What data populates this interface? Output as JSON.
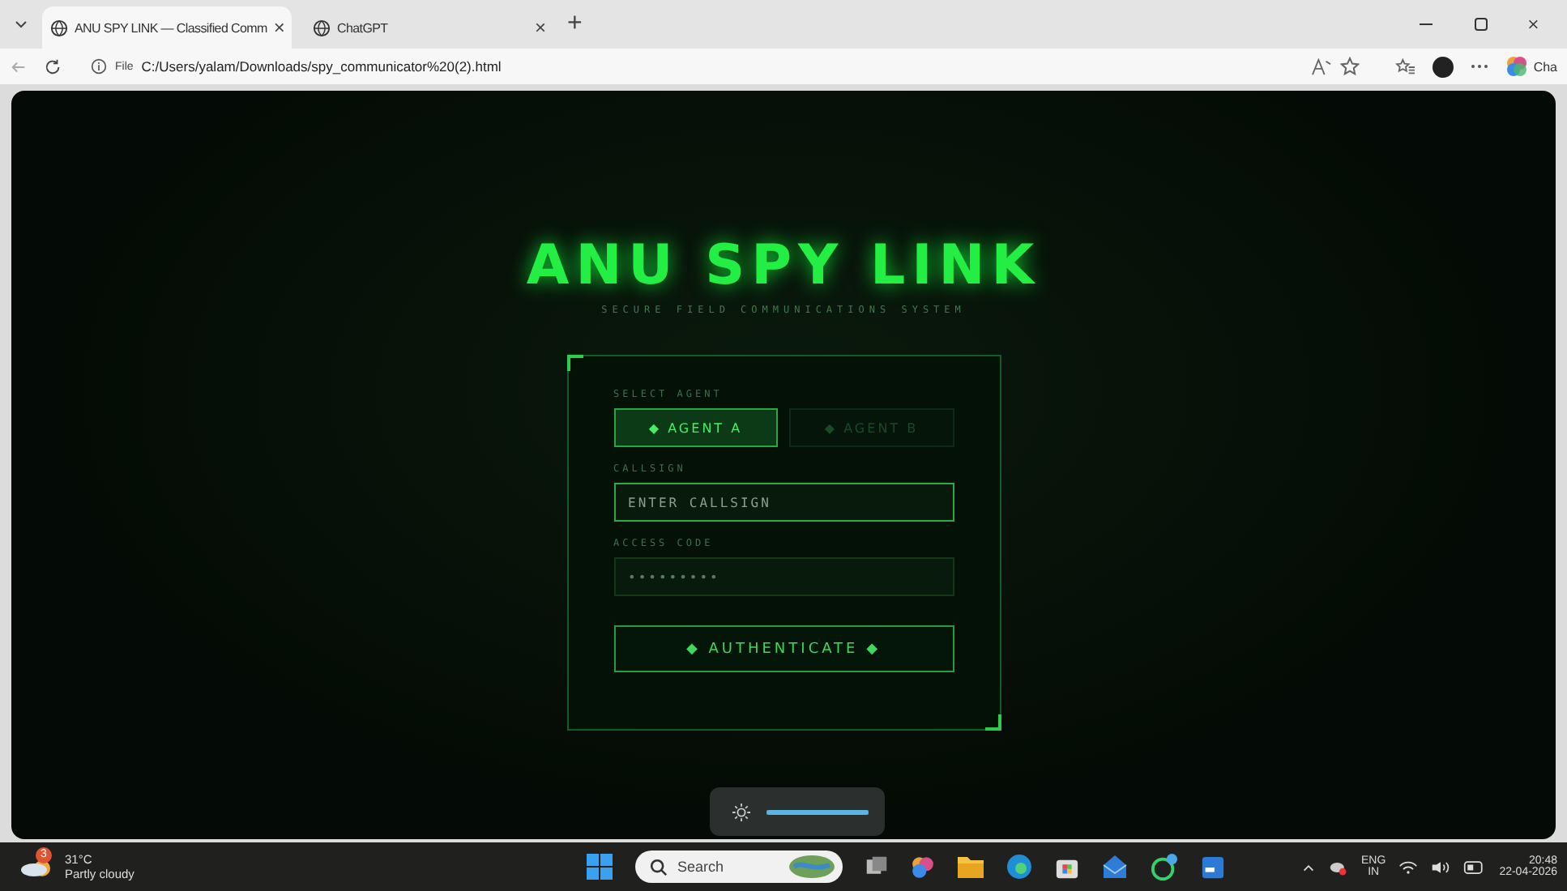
{
  "browser": {
    "tabs": [
      {
        "title": "ANU SPY LINK — Classified Comm",
        "selected": true
      },
      {
        "title": "ChatGPT",
        "selected": false
      }
    ],
    "close_glyph": "×",
    "new_tab_glyph": "+",
    "address": {
      "scheme": "File",
      "url": "C:/Users/yalam/Downloads/spy_communicator%20(2).html"
    },
    "copilot_label": "Cha"
  },
  "page": {
    "title": "ANU SPY LINK",
    "subtitle": "SECURE FIELD COMMUNICATIONS SYSTEM",
    "agent_label": "SELECT AGENT",
    "agents": [
      {
        "label": "◆ AGENT A",
        "selected": true
      },
      {
        "label": "◆ AGENT B",
        "selected": false
      }
    ],
    "callsign": {
      "label": "CALLSIGN",
      "placeholder": "ENTER CALLSIGN"
    },
    "access_code": {
      "label": "ACCESS CODE",
      "placeholder": "•••••••••"
    },
    "submit": "◆ AUTHENTICATE ◆"
  },
  "brightness": {
    "level": 1
  },
  "taskbar": {
    "weather": {
      "temp": "31°C",
      "condition": "Partly cloudy",
      "badge": "3"
    },
    "search": {
      "placeholder": "Search"
    },
    "tray": {
      "lang": "ENG",
      "region": "IN",
      "time": "20:48",
      "date": "22-04-2026"
    }
  }
}
